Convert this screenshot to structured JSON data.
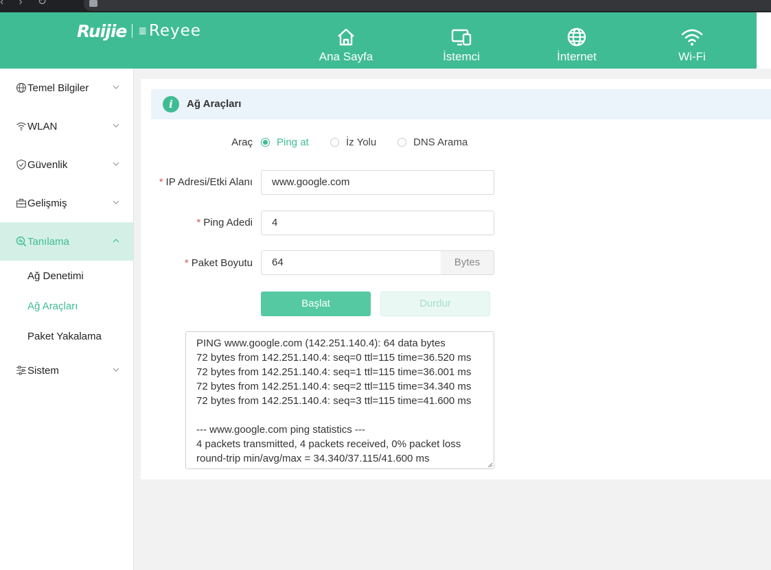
{
  "header": {
    "logo_primary": "Ruijie",
    "logo_secondary": "Reyee",
    "nav": [
      {
        "label": "Ana Sayfa",
        "icon": "home-icon"
      },
      {
        "label": "İstemci",
        "icon": "devices-icon"
      },
      {
        "label": "İnternet",
        "icon": "globe-icon"
      },
      {
        "label": "Wi-Fi",
        "icon": "wifi-icon"
      }
    ]
  },
  "sidebar": {
    "items": [
      {
        "label": "Temel Bilgiler",
        "icon": "globe-icon"
      },
      {
        "label": "WLAN",
        "icon": "wifi-icon"
      },
      {
        "label": "Güvenlik",
        "icon": "shield-icon"
      },
      {
        "label": "Gelişmiş",
        "icon": "toolbox-icon"
      },
      {
        "label": "Tanılama",
        "icon": "diagnose-icon"
      },
      {
        "label": "Sistem",
        "icon": "sliders-icon"
      }
    ],
    "subitems": [
      {
        "label": "Ağ Denetimi"
      },
      {
        "label": "Ağ Araçları"
      },
      {
        "label": "Paket Yakalama"
      }
    ]
  },
  "main": {
    "title": "Ağ Araçları",
    "tool_label": "Araç",
    "tools": [
      "Ping at",
      "İz Yolu",
      "DNS Arama"
    ],
    "selected_tool": "Ping at",
    "ip_label": "IP Adresi/Etki Alanı",
    "ip_value": "www.google.com",
    "count_label": "Ping Adedi",
    "count_value": "4",
    "size_label": "Paket Boyutu",
    "size_value": "64",
    "size_unit": "Bytes",
    "start_button": "Başlat",
    "stop_button": "Durdur",
    "output": "PING www.google.com (142.251.140.4): 64 data bytes\n72 bytes from 142.251.140.4: seq=0 ttl=115 time=36.520 ms\n72 bytes from 142.251.140.4: seq=1 ttl=115 time=36.001 ms\n72 bytes from 142.251.140.4: seq=2 ttl=115 time=34.340 ms\n72 bytes from 142.251.140.4: seq=3 ttl=115 time=41.600 ms\n\n--- www.google.com ping statistics ---\n4 packets transmitted, 4 packets received, 0% packet loss\nround-trip min/avg/max = 34.340/37.115/41.600 ms"
  },
  "colors": {
    "accent": "#3fbc93",
    "banner": "#ebf4fb",
    "required": "#e05050"
  }
}
